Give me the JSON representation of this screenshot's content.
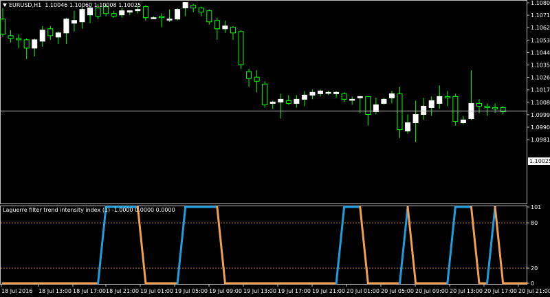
{
  "price_chart": {
    "symbol": "EURUSD,H1",
    "ohlc_text": "1.10046 1.10060 1.10008 1.10025",
    "current_price": "1.10025",
    "current_price_value": 1.10025,
    "y_ticks": [
      "1.10808",
      "1.10718",
      "1.10628",
      "1.10538",
      "1.10448",
      "1.10358",
      "1.10268",
      "1.10178",
      "1.10088",
      "1.09998",
      "1.09908",
      "1.09818"
    ],
    "colors": {
      "bull_body": "#ffffff",
      "bear_body": "#000000",
      "wick": "#00ff00",
      "background": "#000000",
      "grid_line": "#c0c0c0"
    }
  },
  "indicator": {
    "title": "Laguerre filter trend intensity index (1) -1.0000 0.0000 0.0000",
    "y_ticks": [
      "101",
      "80",
      "20",
      "0"
    ],
    "levels": [
      80,
      20
    ],
    "colors": {
      "up": "#1e9fe0",
      "down": "#f0a050",
      "level": "#d98c2e"
    }
  },
  "x_axis": {
    "labels": [
      "18 Jul 2016",
      "18 Jul 13:00",
      "18 Jul 17:00",
      "18 Jul 21:00",
      "19 Jul 01:00",
      "19 Jul 05:00",
      "19 Jul 09:00",
      "19 Jul 13:00",
      "19 Jul 17:00",
      "19 Jul 21:00",
      "20 Jul 01:00",
      "20 Jul 05:00",
      "20 Jul 09:00",
      "20 Jul 13:00",
      "20 Jul 17:00",
      "20 Jul 21:00"
    ]
  },
  "chart_data": {
    "type": "candlestick",
    "title": "EURUSD,H1",
    "ylim": [
      1.098,
      1.1082
    ],
    "candles": [
      {
        "o": 1.1069,
        "h": 1.1077,
        "l": 1.1056,
        "c": 1.1058
      },
      {
        "o": 1.1057,
        "h": 1.1061,
        "l": 1.1052,
        "c": 1.1055
      },
      {
        "o": 1.1055,
        "h": 1.1058,
        "l": 1.1048,
        "c": 1.1054
      },
      {
        "o": 1.1054,
        "h": 1.1055,
        "l": 1.104,
        "c": 1.1048
      },
      {
        "o": 1.1048,
        "h": 1.1055,
        "l": 1.1042,
        "c": 1.1054
      },
      {
        "o": 1.1053,
        "h": 1.1064,
        "l": 1.1049,
        "c": 1.1061
      },
      {
        "o": 1.1062,
        "h": 1.1064,
        "l": 1.1054,
        "c": 1.1057
      },
      {
        "o": 1.1056,
        "h": 1.106,
        "l": 1.1051,
        "c": 1.1059
      },
      {
        "o": 1.1059,
        "h": 1.107,
        "l": 1.1051,
        "c": 1.1069
      },
      {
        "o": 1.1066,
        "h": 1.1075,
        "l": 1.106,
        "c": 1.1068
      },
      {
        "o": 1.1067,
        "h": 1.1078,
        "l": 1.1062,
        "c": 1.1076
      },
      {
        "o": 1.1072,
        "h": 1.1078,
        "l": 1.1066,
        "c": 1.1077
      },
      {
        "o": 1.1077,
        "h": 1.108,
        "l": 1.1069,
        "c": 1.1071
      },
      {
        "o": 1.1078,
        "h": 1.1079,
        "l": 1.1071,
        "c": 1.1073
      },
      {
        "o": 1.1073,
        "h": 1.1075,
        "l": 1.107,
        "c": 1.1071
      },
      {
        "o": 1.1072,
        "h": 1.1077,
        "l": 1.107,
        "c": 1.1075
      },
      {
        "o": 1.1074,
        "h": 1.1075,
        "l": 1.1072,
        "c": 1.1075
      },
      {
        "o": 1.1075,
        "h": 1.1079,
        "l": 1.1073,
        "c": 1.1076
      },
      {
        "o": 1.1078,
        "h": 1.1079,
        "l": 1.1068,
        "c": 1.107
      },
      {
        "o": 1.107,
        "h": 1.1071,
        "l": 1.1069,
        "c": 1.107
      },
      {
        "o": 1.1071,
        "h": 1.1073,
        "l": 1.1063,
        "c": 1.107
      },
      {
        "o": 1.1069,
        "h": 1.1076,
        "l": 1.1067,
        "c": 1.1069
      },
      {
        "o": 1.1069,
        "h": 1.1077,
        "l": 1.1068,
        "c": 1.1076
      },
      {
        "o": 1.1077,
        "h": 1.1081,
        "l": 1.1071,
        "c": 1.1081
      },
      {
        "o": 1.1079,
        "h": 1.108,
        "l": 1.1074,
        "c": 1.1077
      },
      {
        "o": 1.1077,
        "h": 1.1078,
        "l": 1.1071,
        "c": 1.1074
      },
      {
        "o": 1.1075,
        "h": 1.1076,
        "l": 1.1065,
        "c": 1.1067
      },
      {
        "o": 1.1068,
        "h": 1.107,
        "l": 1.1054,
        "c": 1.1062
      },
      {
        "o": 1.1062,
        "h": 1.1068,
        "l": 1.1059,
        "c": 1.1064
      },
      {
        "o": 1.1063,
        "h": 1.1064,
        "l": 1.1054,
        "c": 1.1059
      },
      {
        "o": 1.106,
        "h": 1.1061,
        "l": 1.1033,
        "c": 1.1036
      },
      {
        "o": 1.1031,
        "h": 1.1033,
        "l": 1.102,
        "c": 1.1026
      },
      {
        "o": 1.1027,
        "h": 1.1032,
        "l": 1.1016,
        "c": 1.1024
      },
      {
        "o": 1.1022,
        "h": 1.1024,
        "l": 1.1005,
        "c": 1.1007
      },
      {
        "o": 1.1008,
        "h": 1.101,
        "l": 1.1004,
        "c": 1.1009
      },
      {
        "o": 1.1009,
        "h": 1.1015,
        "l": 1.0997,
        "c": 1.1011
      },
      {
        "o": 1.101,
        "h": 1.1014,
        "l": 1.1007,
        "c": 1.1008
      },
      {
        "o": 1.1008,
        "h": 1.1014,
        "l": 1.1005,
        "c": 1.1011
      },
      {
        "o": 1.1011,
        "h": 1.1017,
        "l": 1.1006,
        "c": 1.1014
      },
      {
        "o": 1.1014,
        "h": 1.1018,
        "l": 1.1011,
        "c": 1.1016
      },
      {
        "o": 1.1015,
        "h": 1.1018,
        "l": 1.1013,
        "c": 1.1017
      },
      {
        "o": 1.1016,
        "h": 1.1017,
        "l": 1.1014,
        "c": 1.1016
      },
      {
        "o": 1.1015,
        "h": 1.1017,
        "l": 1.1012,
        "c": 1.1016
      },
      {
        "o": 1.1015,
        "h": 1.1016,
        "l": 1.1009,
        "c": 1.1011
      },
      {
        "o": 1.1011,
        "h": 1.1013,
        "l": 1.1007,
        "c": 1.1011
      },
      {
        "o": 1.1012,
        "h": 1.1013,
        "l": 1.1001,
        "c": 1.1013
      },
      {
        "o": 1.1013,
        "h": 1.1013,
        "l": 1.0992,
        "c": 1.1
      },
      {
        "o": 1.1002,
        "h": 1.1012,
        "l": 1.1,
        "c": 1.1007
      },
      {
        "o": 1.1008,
        "h": 1.1012,
        "l": 1.1007,
        "c": 1.1011
      },
      {
        "o": 1.1012,
        "h": 1.1017,
        "l": 1.1008,
        "c": 1.1015
      },
      {
        "o": 1.1015,
        "h": 1.102,
        "l": 1.0983,
        "c": 1.0989
      },
      {
        "o": 1.0988,
        "h": 1.1,
        "l": 1.0986,
        "c": 1.0994
      },
      {
        "o": 1.0994,
        "h": 1.101,
        "l": 1.098,
        "c": 1.1
      },
      {
        "o": 1.1,
        "h": 1.1012,
        "l": 1.0996,
        "c": 1.1006
      },
      {
        "o": 1.1005,
        "h": 1.1013,
        "l": 1.0999,
        "c": 1.101
      },
      {
        "o": 1.1008,
        "h": 1.1021,
        "l": 1.1004,
        "c": 1.1013
      },
      {
        "o": 1.1013,
        "h": 1.1017,
        "l": 1.1006,
        "c": 1.1012
      },
      {
        "o": 1.1013,
        "h": 1.1015,
        "l": 1.0992,
        "c": 1.0995
      },
      {
        "o": 1.0994,
        "h": 1.0999,
        "l": 1.0993,
        "c": 1.0996
      },
      {
        "o": 1.0997,
        "h": 1.1032,
        "l": 1.0996,
        "c": 1.1008
      },
      {
        "o": 1.1008,
        "h": 1.1011,
        "l": 1.1001,
        "c": 1.1006
      },
      {
        "o": 1.1006,
        "h": 1.1008,
        "l": 1.0999,
        "c": 1.1005
      },
      {
        "o": 1.1005,
        "h": 1.1008,
        "l": 1.1001,
        "c": 1.1004
      },
      {
        "o": 1.1005,
        "h": 1.1006,
        "l": 1.1,
        "c": 1.1002
      }
    ],
    "indicator_series": [
      0,
      0,
      0,
      0,
      0,
      0,
      0,
      0,
      0,
      0,
      0,
      0,
      0,
      101,
      101,
      101,
      101,
      101,
      0,
      0,
      0,
      0,
      0,
      101,
      101,
      101,
      101,
      101,
      0,
      0,
      0,
      0,
      0,
      0,
      0,
      0,
      0,
      0,
      0,
      0,
      0,
      0,
      0,
      101,
      101,
      101,
      0,
      0,
      0,
      0,
      0,
      101,
      0,
      0,
      0,
      0,
      0,
      101,
      101,
      101,
      0,
      0,
      101,
      0,
      0,
      0,
      0
    ]
  }
}
